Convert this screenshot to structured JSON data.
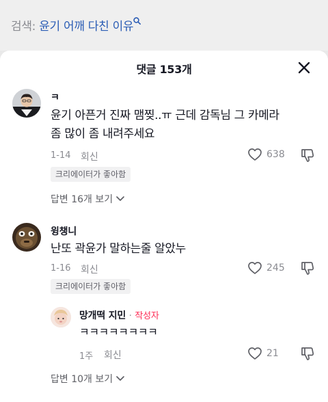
{
  "search": {
    "prefix": "검색:",
    "query": "윤기 어깨 다친 이유",
    "icon": "search-icon"
  },
  "sheet": {
    "title": "댓글 153개",
    "close_icon": "close-icon"
  },
  "comments": [
    {
      "username": "ㅋ",
      "text_line1": "윤기 아픈거 진짜 맴찢..ㅠ 근데 감독님 그 카메라",
      "text_line2": "좀 많이 좀 내려주세요",
      "date": "1-14",
      "reply_label": "회신",
      "likes": "638",
      "creator_liked": "크리에이터가 좋아함",
      "view_replies": "답변 16개 보기"
    },
    {
      "username": "윙챙니",
      "text_line1": "난또 곽윤가 말하는줄 알았누",
      "date": "1-16",
      "reply_label": "회신",
      "likes": "245",
      "creator_liked": "크리에이터가 좋아함",
      "reply": {
        "username": "망개떡 지민",
        "dot": "·",
        "author_badge": "작성자",
        "text": "ㅋㅋㅋㅋㅋㅋㅋㅋ",
        "date": "1주",
        "reply_label": "회신",
        "likes": "21"
      },
      "view_replies": "답변 10개 보기"
    }
  ],
  "colors": {
    "accent_link": "#2b5db5",
    "author_badge": "#fe2c55",
    "muted": "#8a8b91"
  }
}
